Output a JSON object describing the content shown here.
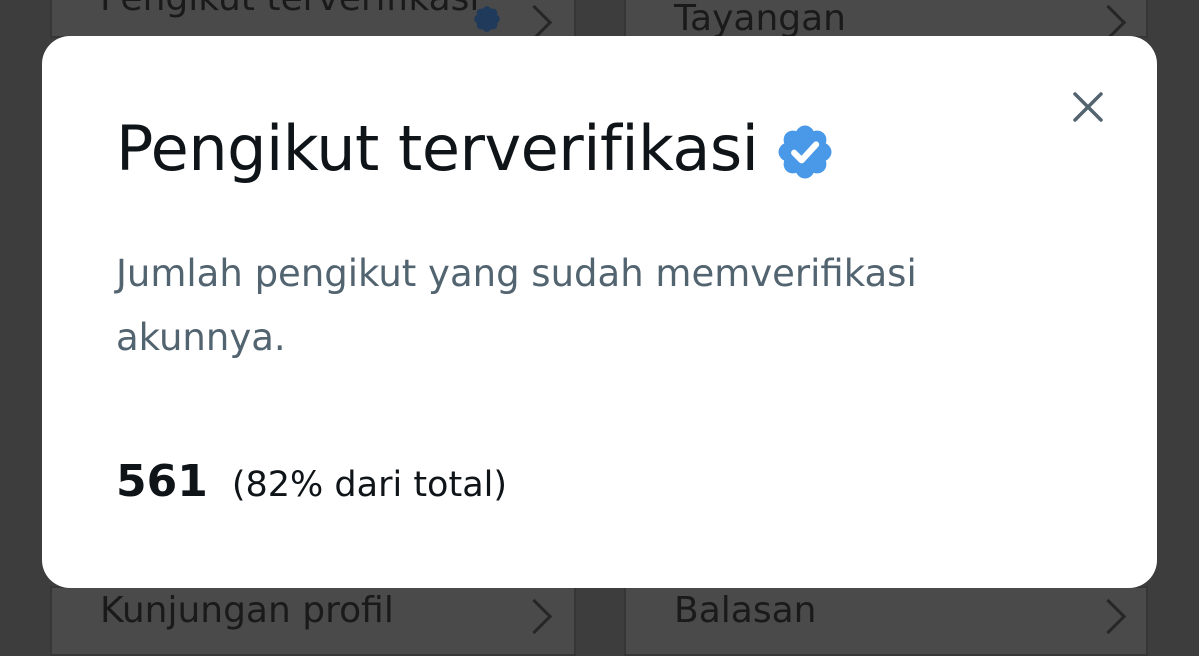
{
  "background": {
    "top_left_label": "Pengikut terverifikasi",
    "top_right_label": "Tayangan",
    "bottom_left_label": "Kunjungan profil",
    "bottom_right_label": "Balasan"
  },
  "modal": {
    "title": "Pengikut terverifikasi",
    "description": "Jumlah pengikut yang sudah memverifikasi akunnya.",
    "stat_value": "561",
    "stat_note": "(82% dari total)",
    "close_icon": "close-icon",
    "badge_icon": "verified-badge-icon"
  },
  "colors": {
    "badge_blue": "#4a99e9",
    "text_primary": "#0f1419",
    "text_secondary": "#536471"
  }
}
